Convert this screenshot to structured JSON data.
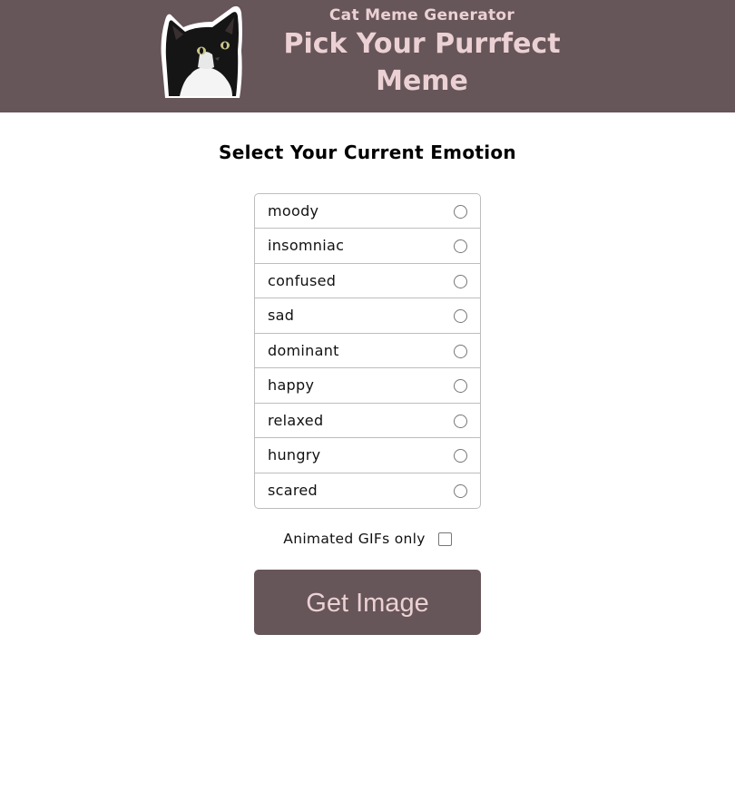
{
  "header": {
    "subtitle": "Cat Meme Generator",
    "title": "Pick Your Purrfect Meme"
  },
  "section": {
    "title": "Select Your Current Emotion"
  },
  "emotions": [
    {
      "label": "moody"
    },
    {
      "label": "insomniac"
    },
    {
      "label": "confused"
    },
    {
      "label": "sad"
    },
    {
      "label": "dominant"
    },
    {
      "label": "happy"
    },
    {
      "label": "relaxed"
    },
    {
      "label": "hungry"
    },
    {
      "label": "scared"
    }
  ],
  "gif_option": {
    "label": "Animated GIFs only",
    "checked": false
  },
  "button": {
    "label": "Get Image"
  },
  "colors": {
    "brand": "#665559",
    "brand_text": "#ecd1d4",
    "border": "#bdbdbd"
  }
}
